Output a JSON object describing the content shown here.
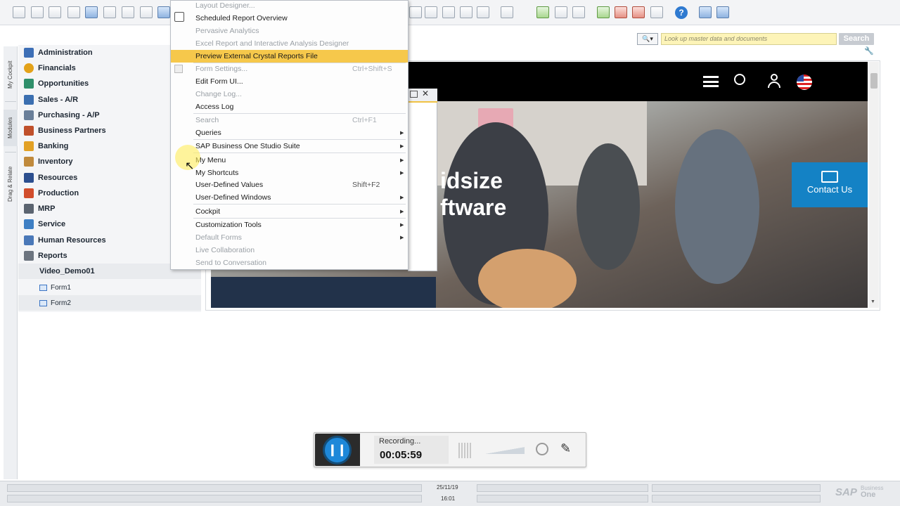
{
  "menu": {
    "items": [
      {
        "label": "Layout Designer...",
        "shortcut": "",
        "disabled": true,
        "submenu": false
      },
      {
        "label": "Scheduled Report Overview",
        "shortcut": "",
        "disabled": false,
        "submenu": false
      },
      {
        "label": "Pervasive Analytics",
        "shortcut": "",
        "disabled": true,
        "submenu": false
      },
      {
        "label": "Excel Report and Interactive Analysis Designer",
        "shortcut": "",
        "disabled": true,
        "submenu": false
      },
      {
        "label": "Preview External Crystal Reports File",
        "shortcut": "",
        "disabled": false,
        "submenu": false,
        "highlighted": true
      },
      {
        "label": "Form Settings...",
        "shortcut": "Ctrl+Shift+S",
        "disabled": true,
        "submenu": false
      },
      {
        "label": "Edit Form UI...",
        "shortcut": "",
        "disabled": false,
        "submenu": false
      },
      {
        "label": "Change Log...",
        "shortcut": "",
        "disabled": true,
        "submenu": false
      },
      {
        "label": "Access Log",
        "shortcut": "",
        "disabled": false,
        "submenu": false
      },
      {
        "label": "Search",
        "shortcut": "Ctrl+F1",
        "disabled": true,
        "submenu": false
      },
      {
        "label": "Queries",
        "shortcut": "",
        "disabled": false,
        "submenu": true
      },
      {
        "label": "SAP Business One Studio Suite",
        "shortcut": "",
        "disabled": false,
        "submenu": true
      },
      {
        "label": "My Menu",
        "shortcut": "",
        "disabled": false,
        "submenu": true
      },
      {
        "label": "My Shortcuts",
        "shortcut": "",
        "disabled": false,
        "submenu": true
      },
      {
        "label": "User-Defined Values",
        "shortcut": "Shift+F2",
        "disabled": false,
        "submenu": false
      },
      {
        "label": "User-Defined Windows",
        "shortcut": "",
        "disabled": false,
        "submenu": true
      },
      {
        "label": "Cockpit",
        "shortcut": "",
        "disabled": false,
        "submenu": true
      },
      {
        "label": "Customization Tools",
        "shortcut": "",
        "disabled": false,
        "submenu": true
      },
      {
        "label": "Default Forms",
        "shortcut": "",
        "disabled": true,
        "submenu": true
      },
      {
        "label": "Live Collaboration",
        "shortcut": "",
        "disabled": true,
        "submenu": false
      },
      {
        "label": "Send to Conversation",
        "shortcut": "",
        "disabled": true,
        "submenu": false
      }
    ]
  },
  "rail": {
    "tabs": [
      "My Cockpit",
      "Modules",
      "Drag & Relate"
    ]
  },
  "modules": [
    {
      "label": "Administration",
      "color": "#3d6fb6"
    },
    {
      "label": "Financials",
      "color": "#e3a21a"
    },
    {
      "label": "Opportunities",
      "color": "#2f8f6b"
    },
    {
      "label": "Sales - A/R",
      "color": "#3b6fb0"
    },
    {
      "label": "Purchasing - A/P",
      "color": "#6a7f99"
    },
    {
      "label": "Business Partners",
      "color": "#c0502b"
    },
    {
      "label": "Banking",
      "color": "#e2a125"
    },
    {
      "label": "Inventory",
      "color": "#c08a3c"
    },
    {
      "label": "Resources",
      "color": "#2c4f8f"
    },
    {
      "label": "Production",
      "color": "#d14d2c"
    },
    {
      "label": "MRP",
      "color": "#5b6470"
    },
    {
      "label": "Service",
      "color": "#3e7fc4"
    },
    {
      "label": "Human Resources",
      "color": "#4a78b8"
    },
    {
      "label": "Reports",
      "color": "#6d7580"
    },
    {
      "label": "Video_Demo01",
      "color": ""
    }
  ],
  "forms": [
    "Form1",
    "Form2"
  ],
  "search": {
    "placeholder": "Look up master data and documents",
    "button": "Search",
    "dropdown": "🔍▾"
  },
  "website": {
    "hero_line1": "idsize",
    "hero_line2": "ftware",
    "contact": "Contact Us"
  },
  "recorder": {
    "status": "Recording...",
    "time": "00:05:59",
    "pause_glyph": "❙❙"
  },
  "statusbar": {
    "date": "25/11/19",
    "time": "16:01",
    "logo": "SAP",
    "logo_sub1": "Business",
    "logo_sub2": "One"
  },
  "colors": {
    "menu_highlight": "#f6c84b",
    "brand_blue": "#1482c5",
    "search_bg": "#fdf4b8"
  }
}
